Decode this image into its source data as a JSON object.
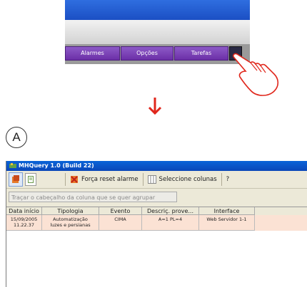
{
  "top_toolbar": {
    "buttons": [
      "Alarmes",
      "Opções",
      "Tarefas"
    ],
    "extra_button_icon": "app-icon"
  },
  "hand_icon": "pointing-hand-icon",
  "arrow_icon": "down-arrow-icon",
  "arrow_color": "#e0261b",
  "step_label": "A",
  "window": {
    "title": "MHQuery 1.0 (Build 22)",
    "toolbar": {
      "reset_label": "Força reset alarme",
      "columns_label": "Seleccione colunas",
      "help_label": "?"
    },
    "group_hint": "Traçar o cabeçalho da coluna que se quer agrupar",
    "columns": [
      "Data início",
      "Tipologia",
      "Evento",
      "Descriç. prove...",
      "Interface"
    ],
    "rows": [
      {
        "date": "15/09/2005",
        "time": "11.22.37",
        "tipologia_1": "Automatização",
        "tipologia_2": "luzes e persianas",
        "evento": "CIMA",
        "descricao": "A=1 PL=4",
        "interface": "Web Servidor 1-1"
      }
    ],
    "row_color": "#fbe2d4"
  }
}
